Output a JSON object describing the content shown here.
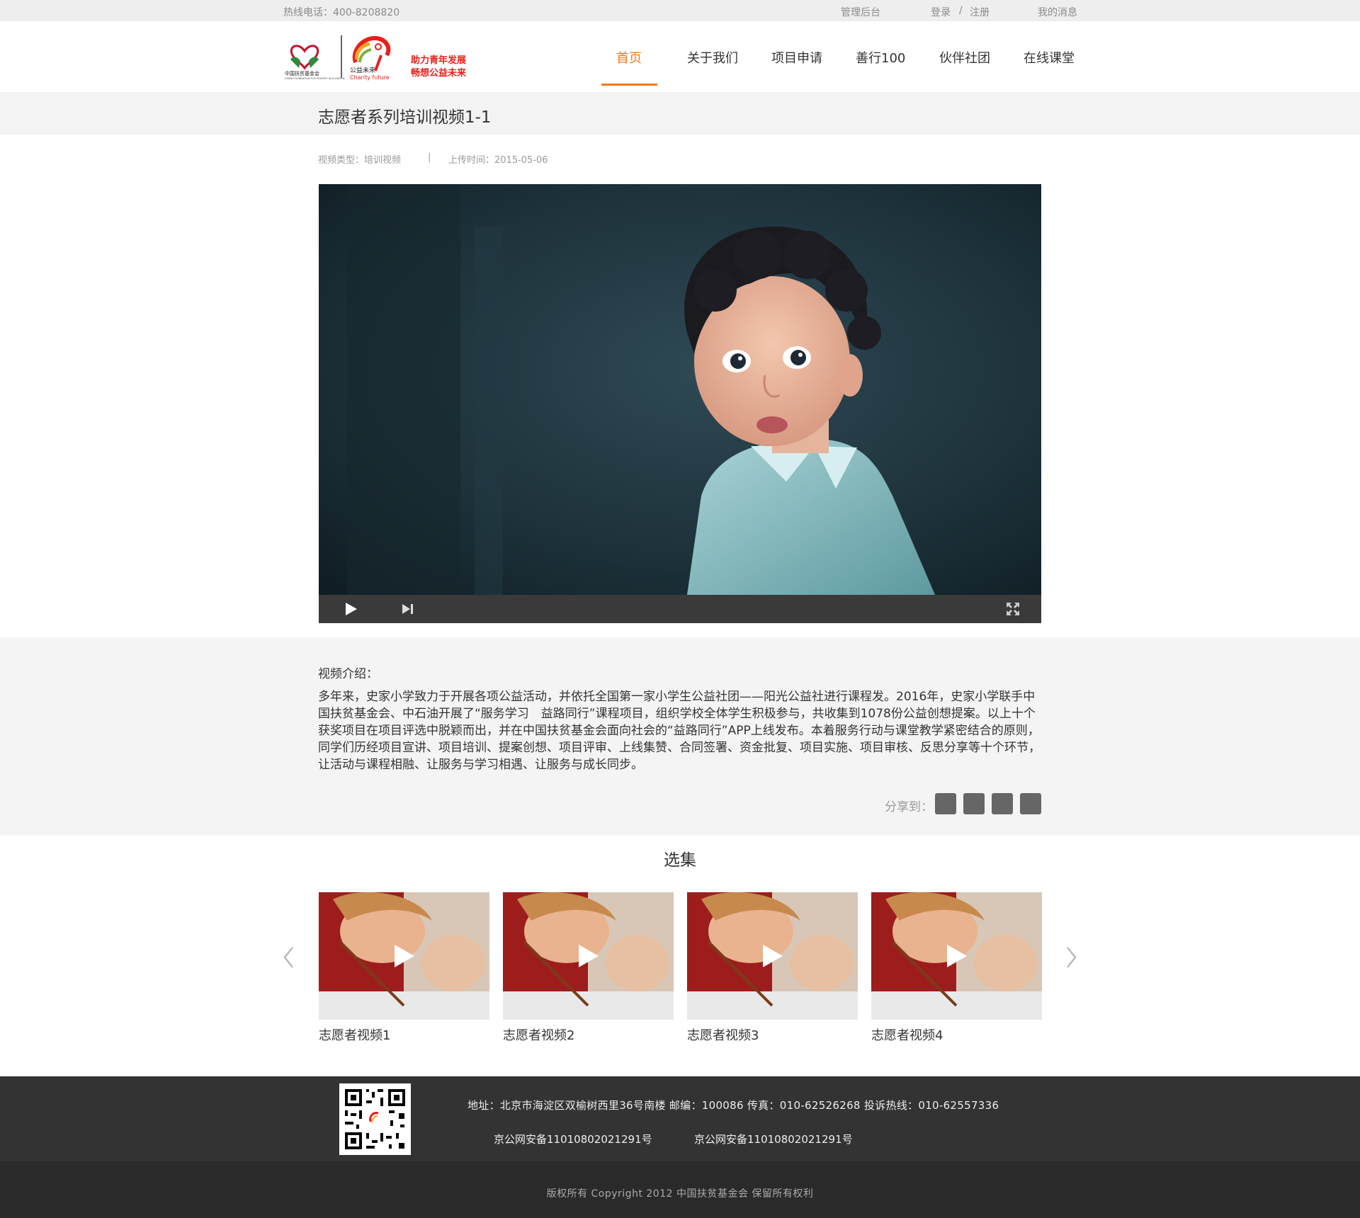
{
  "topbar": {
    "hotline": "热线电话：400-8208820",
    "admin": "管理后台",
    "login": "登录",
    "separator": "/",
    "register": "注册",
    "messages": "我的消息"
  },
  "header": {
    "slogan_line1": "助力青年发展",
    "slogan_line2": "畅想公益未来",
    "logo_text_left": "中国扶贫基金会",
    "logo_text_en": "CHINA FOUNDATION FOR POVERTY ALLEVIATION",
    "logo_text_right": "公益未来",
    "logo_text_right_en": "Charity future"
  },
  "nav": {
    "items": [
      {
        "label": "首页",
        "active": true
      },
      {
        "label": "关于我们",
        "active": false
      },
      {
        "label": "项目申请",
        "active": false
      },
      {
        "label": "善行100",
        "active": false
      },
      {
        "label": "伙伴社团",
        "active": false
      },
      {
        "label": "在线课堂",
        "active": false
      }
    ]
  },
  "page": {
    "title": "志愿者系列培训视频1-1",
    "video_type": "视频类型：培训视频",
    "meta_separator": "|",
    "upload_time": "上传时间：2015-05-06"
  },
  "intro": {
    "label": "视频介绍：",
    "text": "多年来，史家小学致力于开展各项公益活动，并依托全国第一家小学生公益社团——阳光公益社进行课程发。2016年，史家小学联手中国扶贫基金会、中石油开展了“服务学习　益路同行”课程项目，组织学校全体学生积极参与，共收集到1078份公益创想提案。以上十个获奖项目在项目评选中脱颖而出，并在中国扶贫基金会面向社会的“益路同行”APP上线发布。本着服务行动与课堂教学紧密结合的原则，同学们历经项目宣讲、项目培训、提案创想、项目评审、上线集赞、合同签署、资金批复、项目实施、项目审核、反思分享等十个环节，让活动与课程相融、让服务与学习相遇、让服务与成长同步。",
    "share_label": "分享到："
  },
  "episodes": {
    "title": "选集",
    "items": [
      {
        "label": "志愿者视频1"
      },
      {
        "label": "志愿者视频2"
      },
      {
        "label": "志愿者视频3"
      },
      {
        "label": "志愿者视频4"
      }
    ]
  },
  "footer": {
    "address": "地址：北京市海淀区双榆树西里36号南楼  邮编：100086  传真：010-62526268  投诉热线：010-62557336",
    "icp1": "京公网安备110108020212​91号",
    "icp2": "京公网安备11010802021291号",
    "copyright": "版权所有 Copyright 2012 中国扶贫基金会 保留所有权利"
  },
  "colors": {
    "accent": "#f07a1e",
    "slogan": "#e8201a",
    "footer_dark": "#333333",
    "footer_darker": "#2a2a2a"
  }
}
